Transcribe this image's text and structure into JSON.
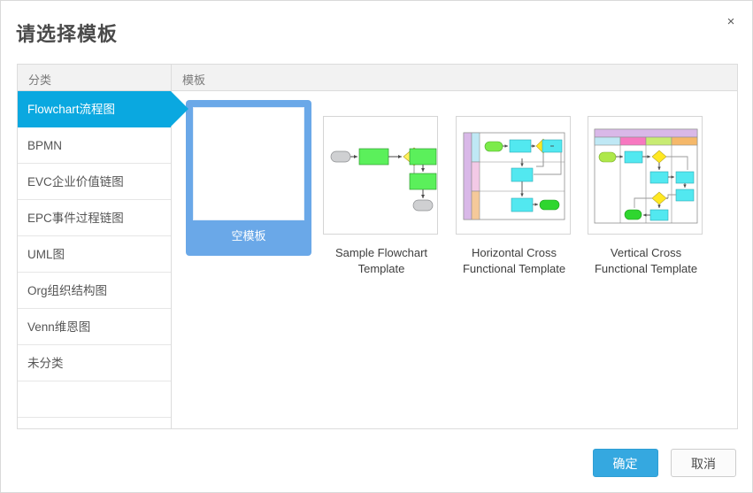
{
  "dialog": {
    "title": "请选择模板",
    "close_label": "×"
  },
  "columns": {
    "category": "分类",
    "template": "模板"
  },
  "sidebar": {
    "items": [
      {
        "label": "Flowchart流程图",
        "selected": true
      },
      {
        "label": "BPMN",
        "selected": false
      },
      {
        "label": "EVC企业价值链图",
        "selected": false
      },
      {
        "label": "EPC事件过程链图",
        "selected": false
      },
      {
        "label": "UML图",
        "selected": false
      },
      {
        "label": "Org组织结构图",
        "selected": false
      },
      {
        "label": "Venn维恩图",
        "selected": false
      },
      {
        "label": "未分类",
        "selected": false
      }
    ]
  },
  "templates": {
    "blank": {
      "label": "空模板",
      "selected": true
    },
    "items": [
      {
        "label": "Sample Flowchart Template",
        "thumb": "sample-flowchart"
      },
      {
        "label": "Horizontal Cross Functional Template",
        "thumb": "horizontal-cross-functional"
      },
      {
        "label": "Vertical Cross Functional Template",
        "thumb": "vertical-cross-functional"
      }
    ]
  },
  "footer": {
    "ok": "确定",
    "cancel": "取消"
  },
  "colors": {
    "accent": "#0aa8e0",
    "primary_button": "#35a8e0",
    "selected_card": "#6aa8e8",
    "border": "#dcdcdc",
    "header_bg": "#f2f2f2"
  }
}
